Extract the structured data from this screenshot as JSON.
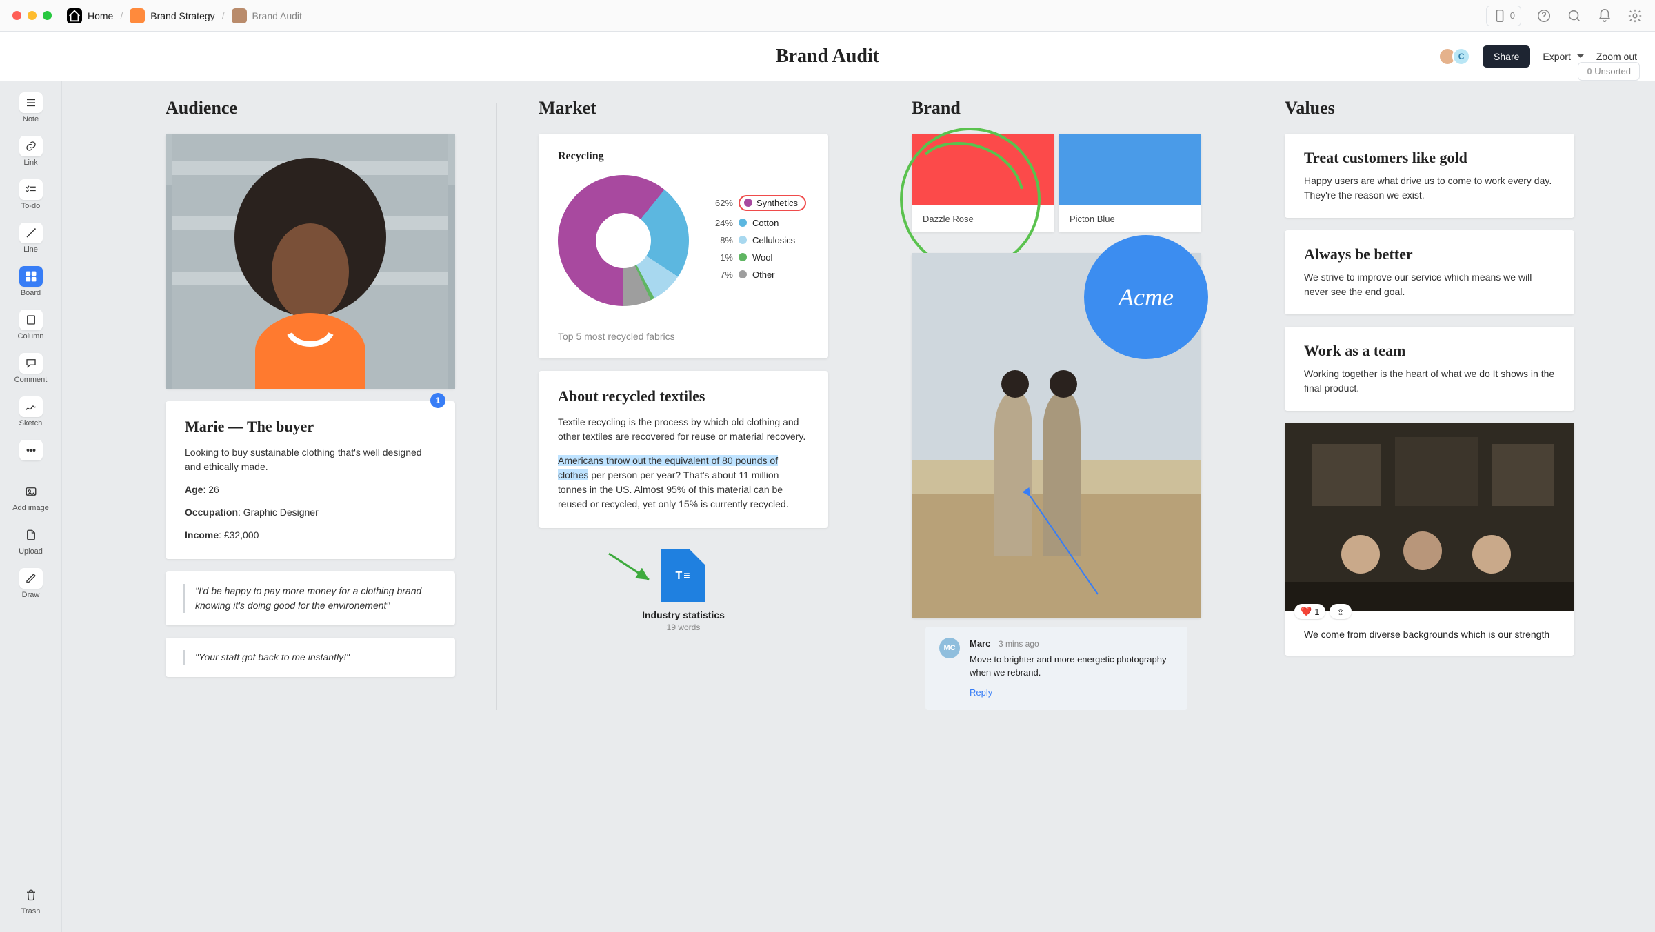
{
  "breadcrumbs": {
    "home": "Home",
    "parent": "Brand Strategy",
    "current": "Brand Audit"
  },
  "chrome": {
    "device_count": "0"
  },
  "title": "Brand Audit",
  "actions": {
    "share": "Share",
    "export": "Export",
    "zoom_out": "Zoom out"
  },
  "unsorted": {
    "count": "0",
    "label": "Unsorted"
  },
  "tools": {
    "note": "Note",
    "link": "Link",
    "todo": "To-do",
    "line": "Line",
    "board": "Board",
    "column": "Column",
    "comment": "Comment",
    "sketch": "Sketch",
    "add_image": "Add image",
    "upload": "Upload",
    "draw": "Draw",
    "trash": "Trash"
  },
  "columns": {
    "audience": {
      "heading": "Audience",
      "badge": "1",
      "persona": {
        "title": "Marie — The buyer",
        "desc": "Looking to buy sustainable clothing that's well designed and ethically made.",
        "age_label": "Age",
        "age": "26",
        "occ_label": "Occupation",
        "occ": "Graphic Designer",
        "inc_label": "Income",
        "inc": "£32,000"
      },
      "quotes": [
        "\"I'd be happy to pay more money for a clothing brand knowing it's doing good for the environement\"",
        "\"Your staff got back to me instantly!\""
      ]
    },
    "market": {
      "heading": "Market",
      "donut_title": "Recycling",
      "caption": "Top 5 most recycled fabrics",
      "textiles": {
        "title": "About recycled textiles",
        "p1": "Textile recycling is the process by which old clothing and other textiles are recovered for reuse or material recovery.",
        "hl": "Americans throw out the equivalent of 80 pounds of clothes",
        "p2_rest": " per person per year? That's about 11 million tonnes in the US. Almost 95% of this material can be reused or recycled, yet only 15% is currently recycled."
      },
      "doc": {
        "title": "Industry statistics",
        "sub": "19 words"
      }
    },
    "brand": {
      "heading": "Brand",
      "swatches": [
        {
          "name": "Dazzle Rose",
          "hex": "#fc4a4a"
        },
        {
          "name": "Picton Blue",
          "hex": "#4a9be8"
        }
      ],
      "acme": "Acme",
      "comment": {
        "initials": "MC",
        "author": "Marc",
        "time": "3 mins ago",
        "text": "Move to brighter and more energetic photography when we rebrand.",
        "reply": "Reply"
      }
    },
    "values": {
      "heading": "Values",
      "items": [
        {
          "title": "Treat customers like gold",
          "body": "Happy users are what drive us to come to work every day. They're the reason we exist."
        },
        {
          "title": "Always be better",
          "body": "We strive to improve our service which means we will never see the end goal."
        },
        {
          "title": "Work as a team",
          "body": "Working together is the heart of what we do It shows in the final product."
        }
      ],
      "reaction_count": "1",
      "caption": "We come from diverse backgrounds which is our strength"
    }
  },
  "chart_data": {
    "type": "pie",
    "title": "Recycling",
    "series": [
      {
        "name": "Synthetics",
        "value": 62,
        "color": "#a8499f"
      },
      {
        "name": "Cotton",
        "value": 24,
        "color": "#5cb7e0"
      },
      {
        "name": "Cellulosics",
        "value": 8,
        "color": "#a8d8ef"
      },
      {
        "name": "Wool",
        "value": 1,
        "color": "#5fb562"
      },
      {
        "name": "Other",
        "value": 7,
        "color": "#9e9e9e"
      }
    ],
    "caption": "Top 5 most recycled fabrics",
    "annotations": [
      "Synthetics circled in red"
    ]
  }
}
